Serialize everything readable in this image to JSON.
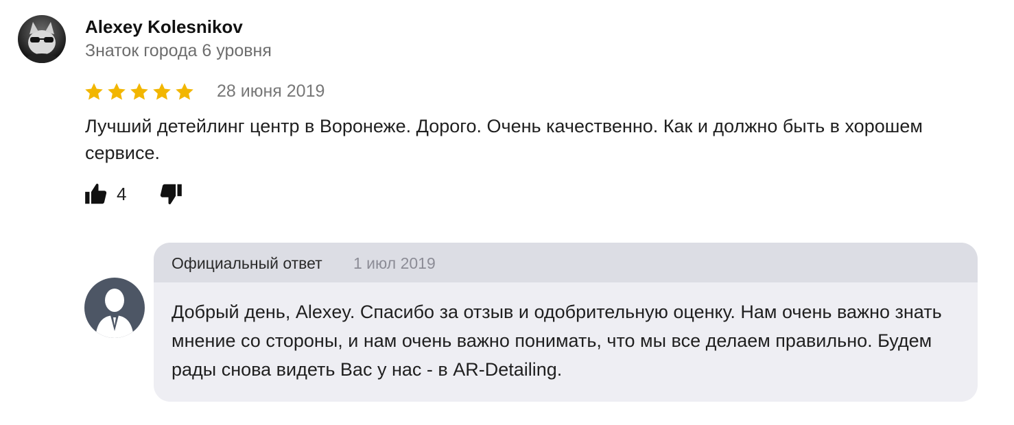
{
  "review": {
    "author_name": "Alexey Kolesnikov",
    "author_level": "Знаток города 6 уровня",
    "rating": 5,
    "rating_max": 5,
    "date": "28 июня 2019",
    "text": "Лучший детейлинг центр в Воронеже. Дорого. Очень качественно. Как и должно быть в хорошем сервисе.",
    "likes": "4",
    "star_color": "#f2b600"
  },
  "reply": {
    "label": "Официальный ответ",
    "date": "1 июл 2019",
    "text": "Добрый день, Alexey. Спасибо за отзыв и одобрительную оценку. Нам очень важно знать мнение со стороны, и нам очень важно понимать, что мы все делаем правильно. Будем рады снова видеть Вас у нас - в AR-Detailing."
  },
  "icons": {
    "like": "thumbs-up-icon",
    "dislike": "thumbs-down-icon",
    "star": "star-icon",
    "author_avatar": "user-avatar",
    "reply_avatar": "business-avatar-silhouette"
  }
}
